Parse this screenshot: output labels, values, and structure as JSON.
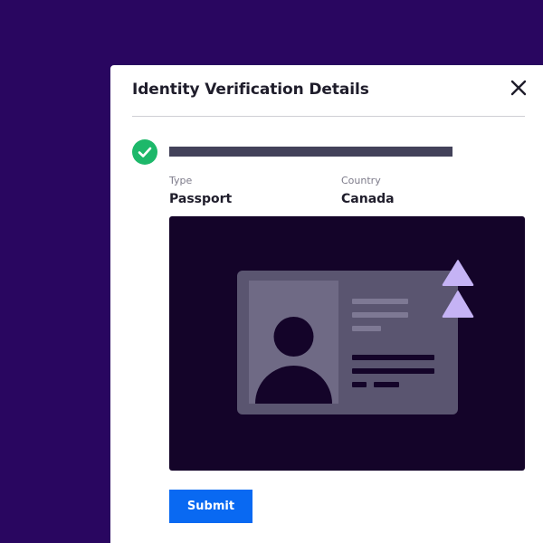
{
  "modal": {
    "title": "Identity Verification Details",
    "close_icon": "close-icon"
  },
  "verification": {
    "status_icon": "check-circle-icon",
    "status_color": "#1db86a",
    "fields": [
      {
        "label": "Type",
        "value": "Passport"
      },
      {
        "label": "Country",
        "value": "Canada"
      }
    ],
    "document_icon": "id-card-icon",
    "accent_icon": "double-chevron-up-icon"
  },
  "actions": {
    "submit_label": "Submit"
  },
  "colors": {
    "background": "#290660",
    "primary_button": "#0969f2",
    "preview_background": "#140429",
    "accent": "#c5b3f5"
  }
}
